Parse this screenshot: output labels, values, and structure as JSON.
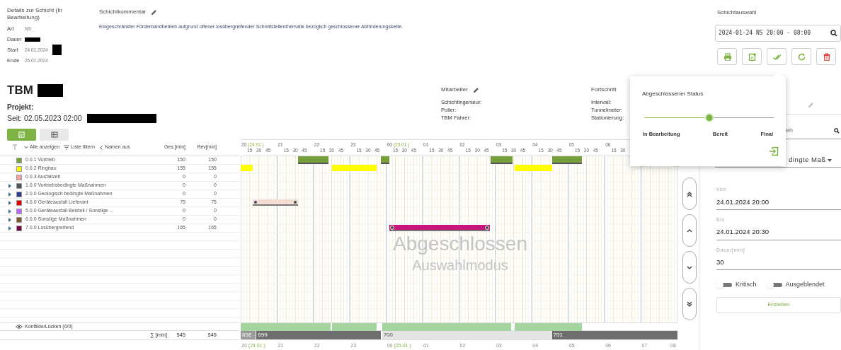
{
  "shift_details": {
    "title": "Details zur Schicht (In Bearbeitung)",
    "fields": [
      {
        "label": "Art",
        "value": "NS"
      },
      {
        "label": "Dauer",
        "redacted": true
      },
      {
        "label": "Start",
        "value": "24.01.2024",
        "redacted": true
      },
      {
        "label": "Ende",
        "value": "25.01.2024"
      }
    ]
  },
  "comment": {
    "title": "Schichtkommentar",
    "text": "Eingeschränkter Förderbandbetrieb aufgrund offener losübergreifender Schnittstellenthematik bezüglich geschlossener Abförderungskette."
  },
  "tbm": {
    "title": "TBM",
    "project_label": "Projekt:",
    "since": "Seit: 02.05.2023 02:00"
  },
  "view_toggle": [
    {
      "kind": "gantt",
      "selected": true
    },
    {
      "kind": "table",
      "selected": false
    }
  ],
  "staff": {
    "title": "Mitarbeiter",
    "labels": [
      "Schichtingenieur:",
      "Polier:",
      "TBM Fahrer:"
    ]
  },
  "progress": {
    "title": "Fortschritt",
    "labels": [
      "Intervall:",
      "Tunnelmeter:",
      "Stationierung:"
    ]
  },
  "table_header": {
    "show_all": "Alle anzeigen",
    "filter": "Liste filtern",
    "names": "Namen aus",
    "col_total": "Ges.[min]",
    "col_rev": "Rev[min]"
  },
  "rows": [
    {
      "name": "0.0.1 Vortrieb",
      "color": "#77a03d",
      "expandable": false,
      "total": "150",
      "rev": "150"
    },
    {
      "name": "0.0.2 Ringbau",
      "color": "#ffff00",
      "expandable": false,
      "total": "155",
      "rev": "155"
    },
    {
      "name": "0.0.3 Ausfallzeit",
      "color": "#f2a4a4",
      "expandable": false,
      "total": "0",
      "rev": "0"
    },
    {
      "name": "1.0.0 Vortriebsbedingte Maßnahmen",
      "color": "#4b5661",
      "expandable": true,
      "total": "0",
      "rev": "0"
    },
    {
      "name": "2.0.0 Geologisch bedingte Maßnahmen",
      "color": "#2f3f8c",
      "expandable": true,
      "total": "0",
      "rev": "0"
    },
    {
      "name": "4.0.0 Geräteausfall Lieferant",
      "color": "#e00000",
      "expandable": true,
      "total": "75",
      "rev": "75"
    },
    {
      "name": "5.0.0 Geräteausfall Beistell / Sonstige ...",
      "color": "#b56cff",
      "expandable": true,
      "total": "0",
      "rev": "0"
    },
    {
      "name": "6.0.0 Sonstige Maßnahmen",
      "color": "#7b5a2e",
      "expandable": true,
      "total": "0",
      "rev": "0"
    },
    {
      "name": "7.0.0 Losübergreifend",
      "color": "#6b0a45",
      "expandable": true,
      "total": "165",
      "rev": "165"
    }
  ],
  "conflicts": {
    "label": "Konflikte/Lücken (0/0)"
  },
  "sum": {
    "label": "∑ [min]",
    "total": "545",
    "rev": "545"
  },
  "shifts": [
    {
      "label": "698",
      "color": "#9a9a9a"
    },
    {
      "label": "699",
      "color": "#6e6e6e"
    },
    {
      "label": "700",
      "color": "#e4e4e4"
    },
    {
      "label": "701",
      "color": "#6e6e6e"
    }
  ],
  "axis_hours": [
    {
      "label": "20",
      "date": "(24.01.)"
    },
    {
      "label": "21"
    },
    {
      "label": "22"
    },
    {
      "label": "23"
    },
    {
      "label": "00",
      "date": "(25.01.)"
    },
    {
      "label": "01"
    },
    {
      "label": "02"
    },
    {
      "label": "03"
    },
    {
      "label": "04"
    },
    {
      "label": "05"
    },
    {
      "label": "06"
    },
    {
      "label": "07"
    },
    {
      "label": "08"
    }
  ],
  "overlay": {
    "title": "Abgeschlossen",
    "subtitle": "Auswahlmodus"
  },
  "header_hours": [
    {
      "label": "20",
      "date": "(24.01.)",
      "minutes": [
        "15",
        "30",
        "45"
      ]
    },
    {
      "label": "21",
      "minutes": [
        "15",
        "30",
        "45"
      ]
    },
    {
      "label": "22",
      "minutes": [
        "15",
        "30",
        "45"
      ]
    },
    {
      "label": "23",
      "minutes": [
        "15",
        "30",
        "45"
      ]
    },
    {
      "label": "00",
      "date": "(25.01.)",
      "minutes": [
        "15",
        "30",
        "45"
      ]
    },
    {
      "label": "01",
      "minutes": [
        "15",
        "30",
        "45"
      ]
    },
    {
      "label": "02",
      "minutes": [
        "15",
        "30",
        "45"
      ]
    },
    {
      "label": "03",
      "minutes": [
        "15",
        "30",
        "45"
      ]
    },
    {
      "label": "04",
      "minutes": [
        "15",
        "30",
        "45"
      ]
    },
    {
      "label": "05",
      "minutes": [
        "15",
        "30",
        "45"
      ]
    },
    {
      "label": "06",
      "minutes": [
        "15",
        "30"
      ]
    }
  ],
  "nav_buttons": [
    {
      "kind": "first"
    },
    {
      "kind": "up"
    },
    {
      "kind": "down"
    },
    {
      "kind": "last"
    }
  ],
  "shift_select": {
    "title": "Schichtauswahl",
    "value": "2024-01-24 NS 20:00 - 08:00"
  },
  "actions": [
    {
      "kind": "print"
    },
    {
      "kind": "export"
    },
    {
      "kind": "approve"
    },
    {
      "kind": "refresh"
    },
    {
      "kind": "delete"
    }
  ],
  "side_search": {
    "value": "en"
  },
  "side_dropdown": {
    "value": "dingte Maß"
  },
  "form": [
    {
      "label": "Von",
      "value": "24.01.2024 20:00"
    },
    {
      "label": "Bis",
      "value": "24.01.2024 20:30"
    },
    {
      "label": "Dauer[min]",
      "value": "30"
    }
  ],
  "switches": [
    {
      "label": "Kritisch",
      "on": false
    },
    {
      "label": "Ausgeblendet",
      "on": false
    }
  ],
  "create_button": "Erstellen",
  "status_popup": {
    "title": "Abgeschlossener Status",
    "level": 0.5,
    "labels": [
      "In Bearbeitung",
      "Bereit",
      "Final"
    ]
  }
}
